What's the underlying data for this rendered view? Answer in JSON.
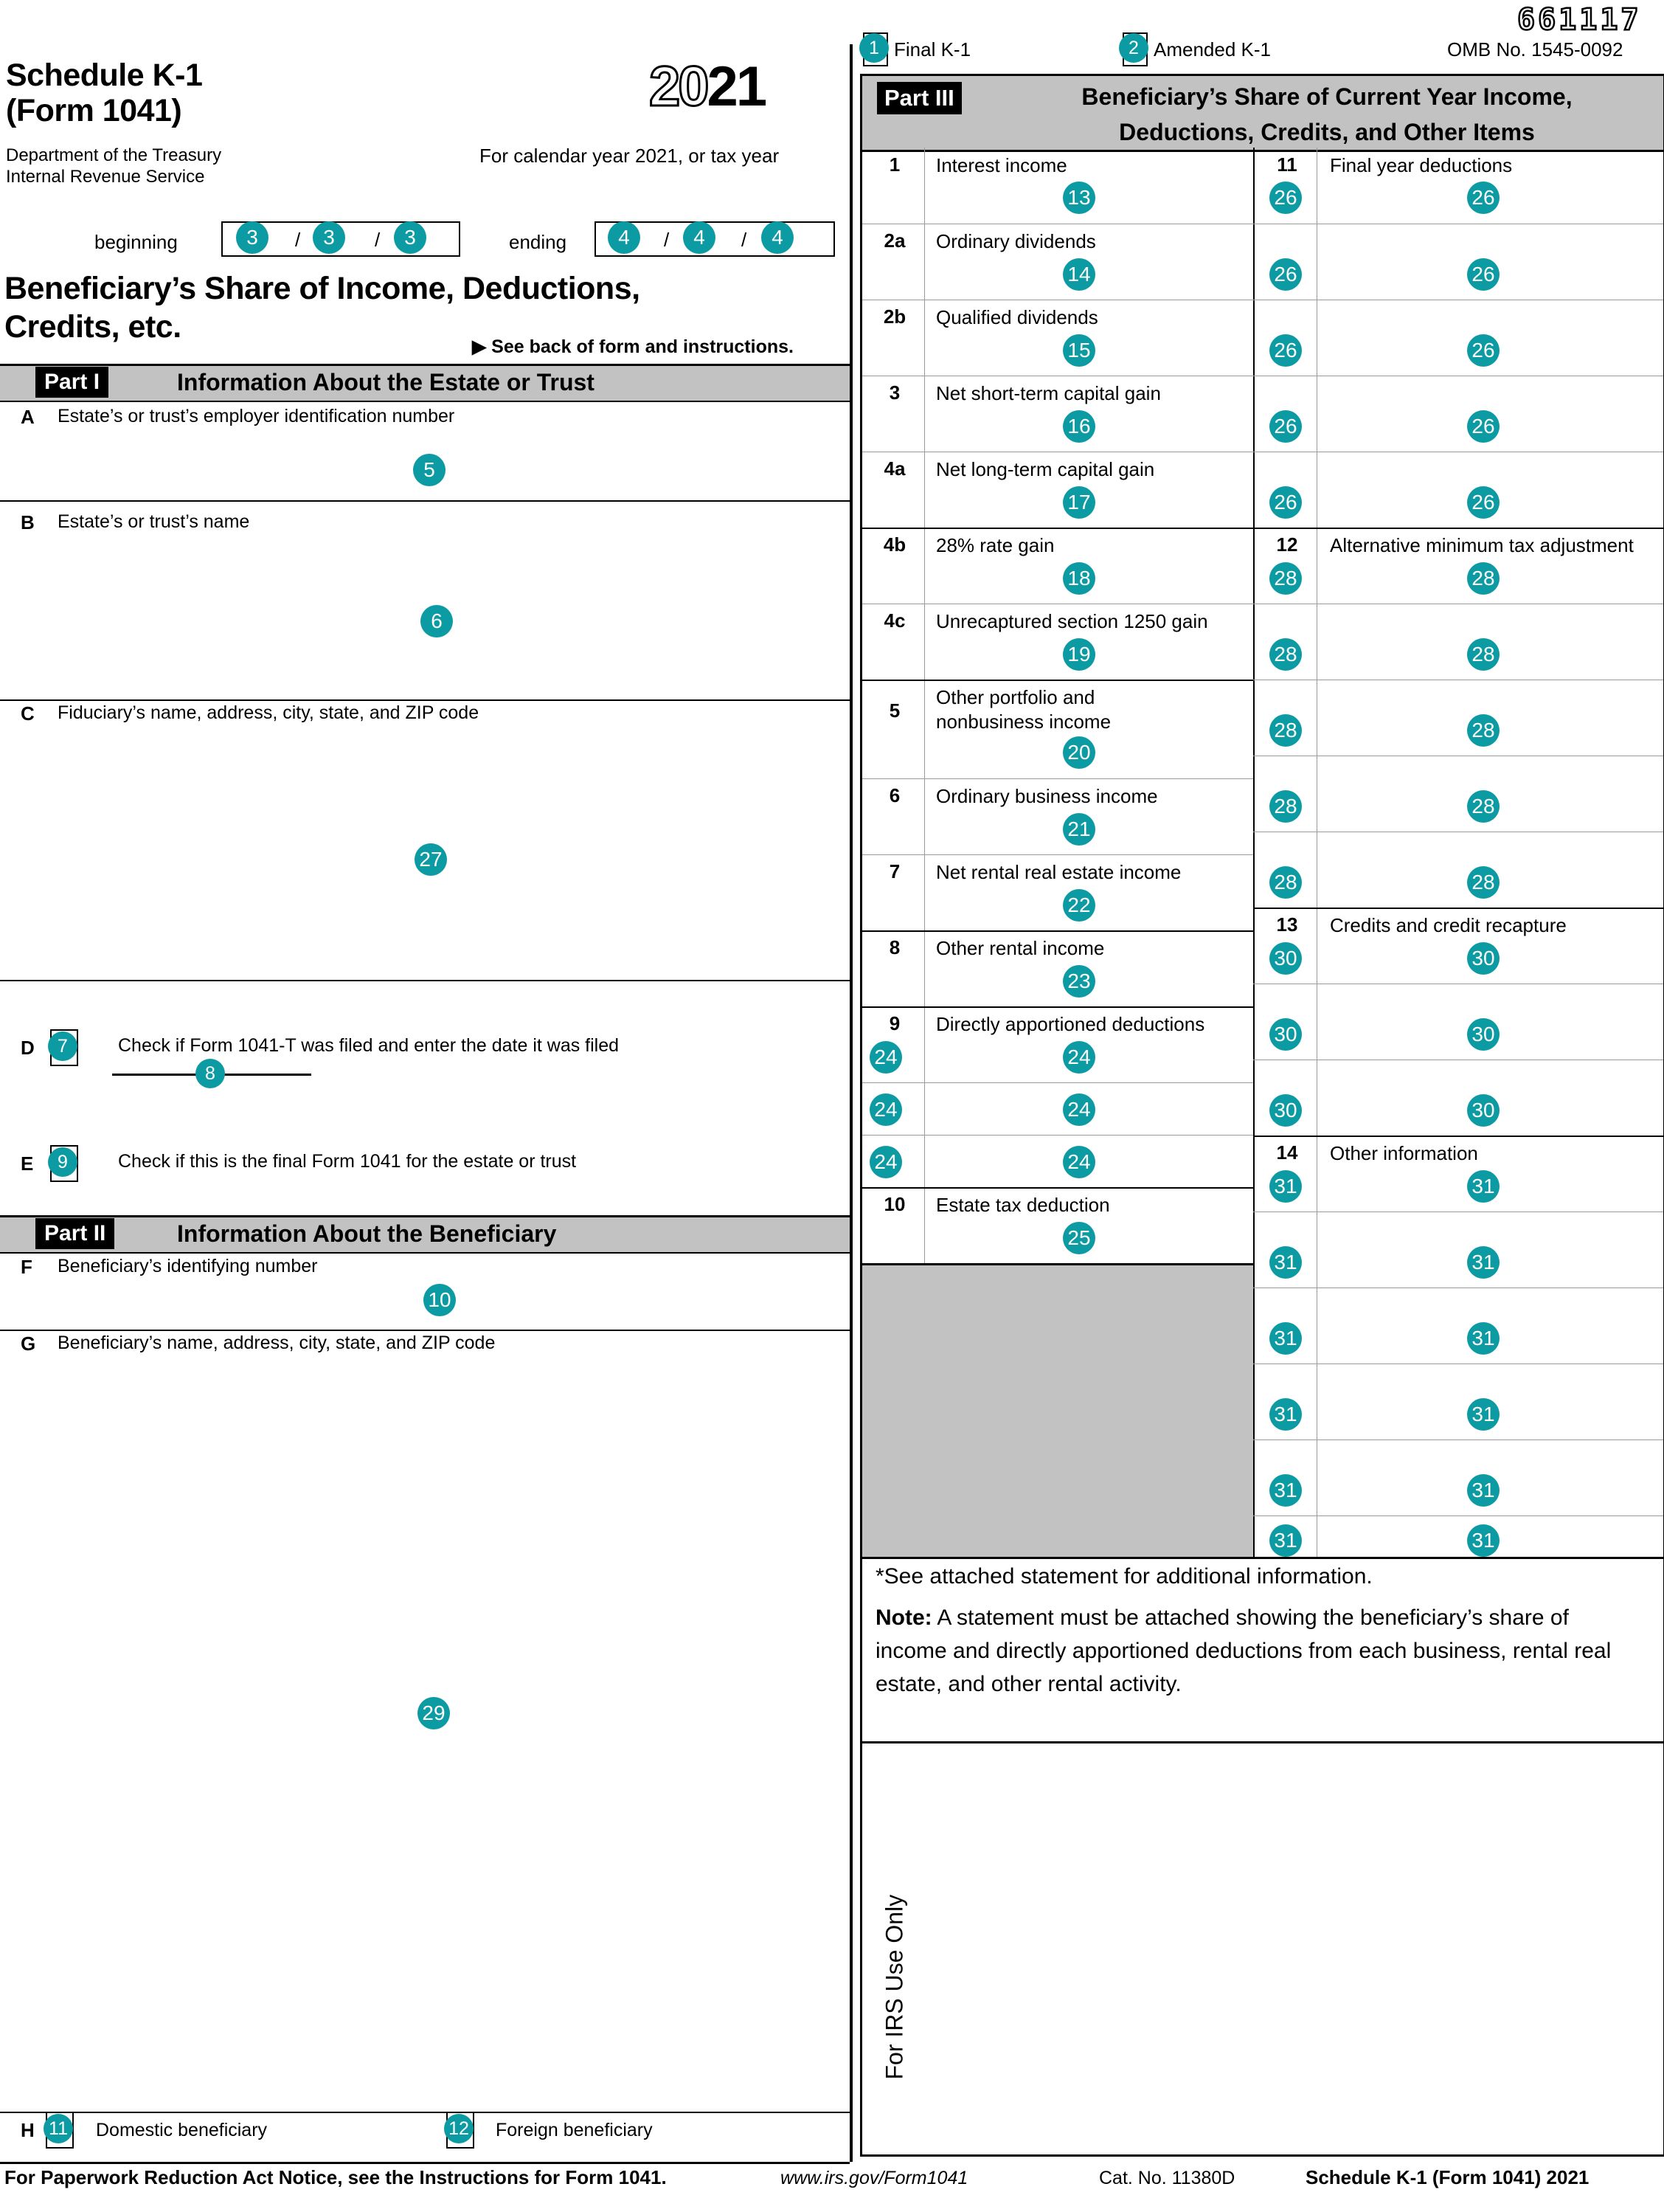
{
  "form": {
    "title_line1": "Schedule K-1",
    "title_line2": "(Form 1041)",
    "department_line1": "Department of the Treasury",
    "department_line2": "Internal Revenue Service",
    "year_prefix": "20",
    "year_suffix": "21",
    "calendar_year_text": "For calendar year 2021, or tax year",
    "beginning_label": "beginning",
    "ending_label": "ending",
    "slash": "/",
    "main_title_line1": "Beneficiary’s Share of Income, Deductions,",
    "main_title_line2": "Credits, etc.",
    "see_back": "▶ See back of form and instructions.",
    "omb_stamp": "661117",
    "omb_label": "OMB No. 1545-0092",
    "final_k1_label": "Final K-1",
    "amended_k1_label": "Amended K-1"
  },
  "part1": {
    "tag": "Part I",
    "title": "Information About the Estate or Trust",
    "rows": [
      {
        "letter": "A",
        "label": "Estate’s or trust’s employer identification number"
      },
      {
        "letter": "B",
        "label": "Estate’s or trust’s name"
      },
      {
        "letter": "C",
        "label": "Fiduciary’s name, address, city, state, and ZIP code"
      },
      {
        "letter": "D",
        "label": "Check if Form 1041-T was filed and enter the date it was filed"
      },
      {
        "letter": "E",
        "label": "Check if this is the final Form 1041 for the estate or trust"
      }
    ]
  },
  "part2": {
    "tag": "Part II",
    "title": "Information About the Beneficiary",
    "rows": [
      {
        "letter": "F",
        "label": "Beneficiary’s identifying number"
      },
      {
        "letter": "G",
        "label": "Beneficiary’s name, address, city, state, and ZIP code"
      },
      {
        "letter": "H",
        "label": ""
      }
    ],
    "domestic_label": "Domestic beneficiary",
    "foreign_label": "Foreign beneficiary"
  },
  "part3": {
    "tag": "Part III",
    "title_line1": "Beneficiary’s Share of Current Year Income,",
    "title_line2": "Deductions, Credits, and Other Items",
    "left_items": [
      {
        "num": "1",
        "label": "Interest income"
      },
      {
        "num": "2a",
        "label": "Ordinary dividends"
      },
      {
        "num": "2b",
        "label": "Qualified dividends"
      },
      {
        "num": "3",
        "label": "Net short-term capital gain"
      },
      {
        "num": "4a",
        "label": "Net long-term capital gain"
      },
      {
        "num": "4b",
        "label": "28% rate gain"
      },
      {
        "num": "4c",
        "label": "Unrecaptured section 1250 gain"
      },
      {
        "num": "5",
        "label": "Other portfolio and\nnonbusiness income"
      },
      {
        "num": "6",
        "label": "Ordinary business income"
      },
      {
        "num": "7",
        "label": "Net rental real estate income"
      },
      {
        "num": "8",
        "label": "Other rental income"
      },
      {
        "num": "9",
        "label": "Directly apportioned deductions"
      },
      {
        "num": "10",
        "label": "Estate tax deduction"
      }
    ],
    "right_items": [
      {
        "num": "11",
        "label": "Final year deductions"
      },
      {
        "num": "12",
        "label": "Alternative minimum tax adjustment"
      },
      {
        "num": "13",
        "label": "Credits and credit recapture"
      },
      {
        "num": "14",
        "label": "Other information"
      }
    ],
    "note_star": "*See attached statement for additional information.",
    "note_bold": "Note:",
    "note_body": " A statement must be attached showing the beneficiary’s share of income and directly apportioned deductions from each business, rental real estate, and other rental activity.",
    "irs_use_only": "For IRS Use Only"
  },
  "footer": {
    "paperwork": "For Paperwork Reduction Act Notice, see the Instructions for Form 1041.",
    "url": "www.irs.gov/Form1041",
    "cat": "Cat. No. 11380D",
    "schedule": "Schedule K-1 (Form 1041) 2021"
  },
  "colors": {
    "marker": "#0d9ba3",
    "bar": "#c2c2c2",
    "line": "#000000"
  },
  "markers": {
    "m1": "1",
    "m2": "2",
    "m3": "3",
    "m4": "4",
    "m5": "5",
    "m6": "6",
    "m7": "7",
    "m8": "8",
    "m9": "9",
    "m10": "10",
    "m11": "11",
    "m12": "12",
    "m13": "13",
    "m14": "14",
    "m15": "15",
    "m16": "16",
    "m17": "17",
    "m18": "18",
    "m19": "19",
    "m20": "20",
    "m21": "21",
    "m22": "22",
    "m23": "23",
    "m24": "24",
    "m25": "25",
    "m26": "26",
    "m27": "27",
    "m28": "28",
    "m29": "29",
    "m30": "30",
    "m31": "31"
  }
}
